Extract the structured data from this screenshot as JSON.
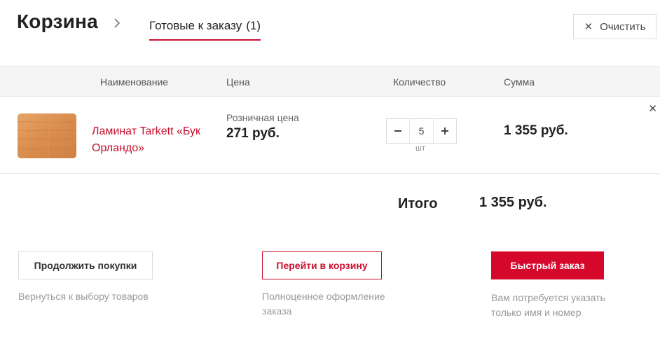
{
  "header": {
    "title": "Корзина",
    "tab_label": "Готовые к заказу",
    "tab_count": "(1)",
    "clear_label": "Очистить"
  },
  "table": {
    "columns": [
      "Наименование",
      "Цена",
      "Количество",
      "Сумма"
    ]
  },
  "items": [
    {
      "name": "Ламинат Tarkett «Бук Орландо»",
      "price_label": "Розничная цена",
      "price": "271 руб.",
      "quantity": "5",
      "unit": "шт",
      "sum": "1 355 руб."
    }
  ],
  "total": {
    "label": "Итого",
    "value": "1 355 руб."
  },
  "actions": {
    "continue_label": "Продолжить покупки",
    "continue_hint": "Вернуться к выбору товаров",
    "cart_label": "Перейти в корзину",
    "cart_hint": "Полноценное оформление заказа",
    "quick_label": "Быстрый заказ",
    "quick_hint": "Вам потребуется указать только имя и номер"
  },
  "colors": {
    "accent": "#c8102e",
    "quick_button": "#d5082b"
  },
  "icons": {
    "title_chevron": "chevron-right-icon",
    "clear": "close-icon",
    "remove": "close-icon",
    "minus": "minus-icon",
    "plus": "plus-icon"
  }
}
